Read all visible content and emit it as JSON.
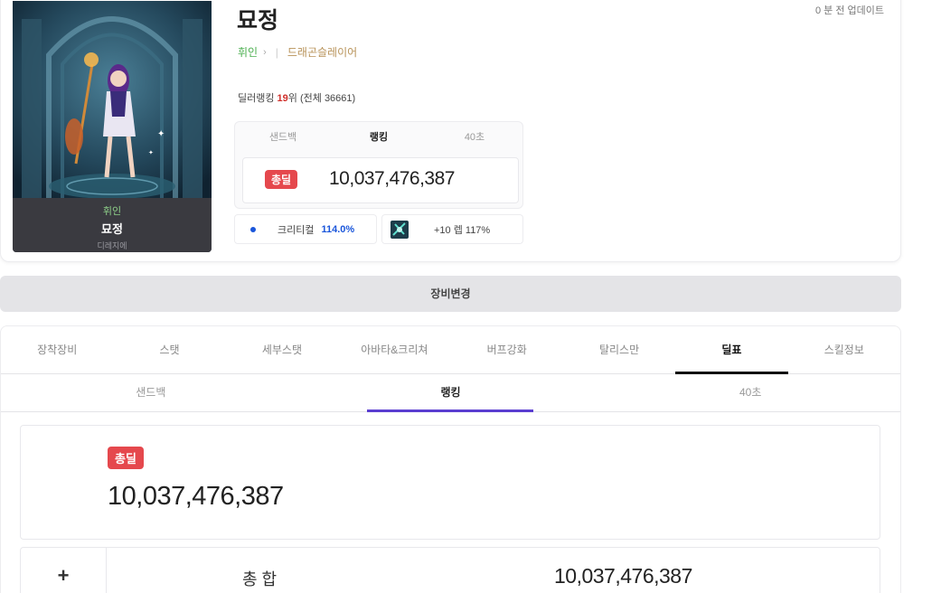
{
  "character": {
    "name": "묘정",
    "class_base": "휘인",
    "class_advanced": "드래곤슬레이어",
    "server": "디레지에",
    "update_time": "0 분 전 업데이트"
  },
  "ranking": {
    "label": "딜러랭킹",
    "rank": "19",
    "rank_suffix": "위",
    "total_text": "(전체 36661)"
  },
  "mini_panel": {
    "tabs": [
      "샌드백",
      "랭킹",
      "40초"
    ],
    "active_tab": "랭킹",
    "badge": "총딜",
    "value": "10,037,476,387"
  },
  "critical": {
    "label": "크리티컬",
    "value": "114.0%",
    "dot_color": "#1a56db"
  },
  "skill_chip": {
    "icon": "skill-icon",
    "text": "+10 렙 117%"
  },
  "equip_button": "장비변경",
  "main_tabs": [
    "장착장비",
    "스탯",
    "세부스탯",
    "아바타&크리쳐",
    "버프강화",
    "탈리스만",
    "딜표",
    "스킬정보"
  ],
  "active_main_tab": "딜표",
  "sub_tabs": [
    "샌드백",
    "랭킹",
    "40초"
  ],
  "active_sub_tab": "랭킹",
  "total": {
    "badge": "총딜",
    "value": "10,037,476,387",
    "badge_color": "#e5484d"
  },
  "summary": {
    "expand_symbol": "+",
    "label": "총 합",
    "value": "10,037,476,387"
  },
  "accent_color": "#5a3ed1"
}
